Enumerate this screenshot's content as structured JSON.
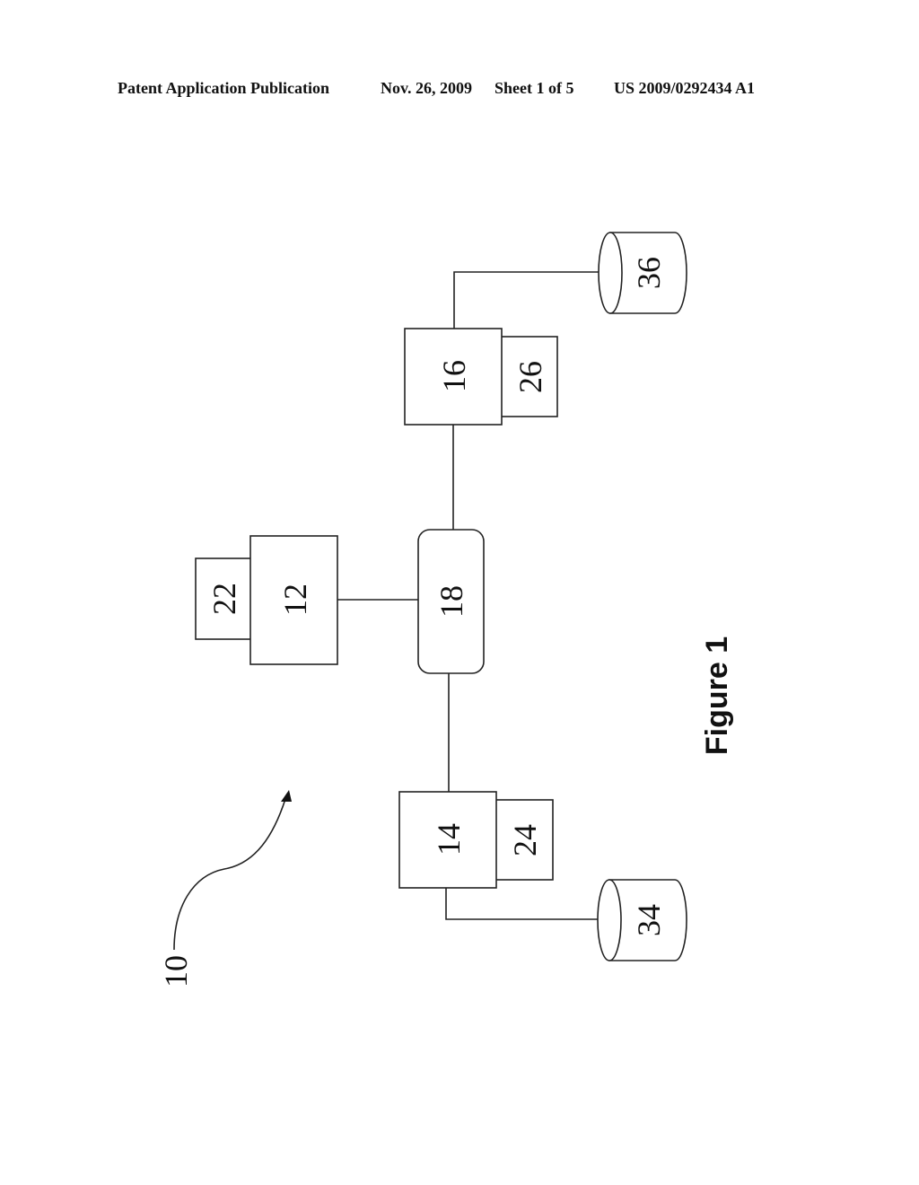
{
  "header": {
    "publication": "Patent Application Publication",
    "date": "Nov. 26, 2009",
    "sheet": "Sheet 1 of 5",
    "number": "US 2009/0292434 A1"
  },
  "figure": {
    "caption": "Figure 1",
    "system_ref": "10",
    "nodes": {
      "n12": "12",
      "n22": "22",
      "n18": "18",
      "n16": "16",
      "n26": "26",
      "n36": "36",
      "n14": "14",
      "n24": "24",
      "n34": "34"
    }
  }
}
